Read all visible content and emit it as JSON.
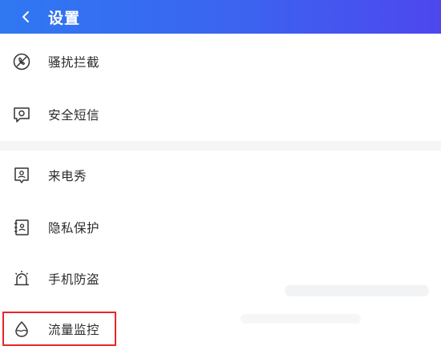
{
  "header": {
    "title": "设置",
    "back_icon": "chevron-left-icon",
    "gradient": [
      "#2f78f2",
      "#4e47ee"
    ]
  },
  "groups": [
    {
      "items": [
        {
          "label": "骚扰拦截",
          "icon": "harass-block-icon"
        },
        {
          "label": "安全短信",
          "icon": "secure-sms-icon"
        }
      ]
    },
    {
      "items": [
        {
          "label": "来电秀",
          "icon": "caller-show-icon"
        },
        {
          "label": "隐私保护",
          "icon": "privacy-protection-icon"
        },
        {
          "label": "手机防盗",
          "icon": "anti-theft-icon"
        },
        {
          "label": "流量监控",
          "icon": "traffic-monitor-icon"
        }
      ]
    }
  ],
  "highlight": {
    "target": "流量监控",
    "color": "#e8262a"
  }
}
